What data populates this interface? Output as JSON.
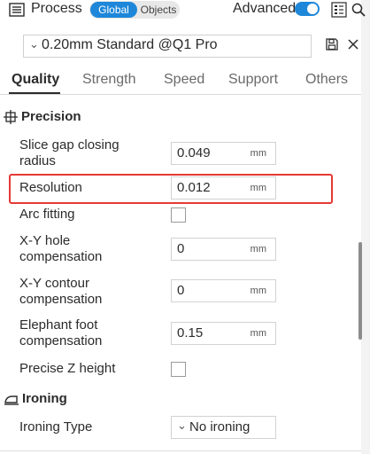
{
  "header": {
    "title": "Process",
    "seg_global": "Global",
    "seg_objects": "Objects",
    "advanced_label": "Advanced",
    "advanced_on": true
  },
  "preset": {
    "value": "0.20mm Standard @Q1 Pro"
  },
  "tabs": [
    {
      "label": "Quality",
      "active": true
    },
    {
      "label": "Strength",
      "active": false
    },
    {
      "label": "Speed",
      "active": false
    },
    {
      "label": "Support",
      "active": false
    },
    {
      "label": "Others",
      "active": false
    }
  ],
  "sections": {
    "precision": {
      "title": "Precision",
      "rows": [
        {
          "label_lines": [
            "Slice gap closing",
            "radius"
          ],
          "value": "0.049",
          "unit": "mm"
        },
        {
          "label_lines": [
            "Resolution"
          ],
          "value": "0.012",
          "unit": "mm"
        },
        {
          "label_lines": [
            "Arc fitting"
          ],
          "checked": false
        },
        {
          "label_lines": [
            "X-Y hole",
            "compensation"
          ],
          "value": "0",
          "unit": "mm"
        },
        {
          "label_lines": [
            "X-Y contour",
            "compensation"
          ],
          "value": "0",
          "unit": "mm"
        },
        {
          "label_lines": [
            "Elephant foot",
            "compensation"
          ],
          "value": "0.15",
          "unit": "mm"
        },
        {
          "label_lines": [
            "Precise Z height"
          ],
          "checked": false
        }
      ]
    },
    "ironing": {
      "title": "Ironing",
      "rows": [
        {
          "label_lines": [
            "Ironing Type"
          ],
          "value": "No ironing"
        }
      ]
    }
  },
  "colors": {
    "accent": "#1e87d9",
    "highlight": "#e53935"
  }
}
